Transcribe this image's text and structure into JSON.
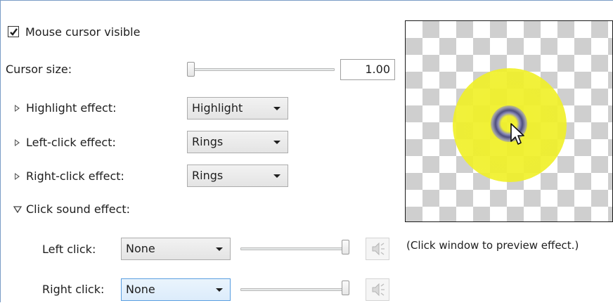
{
  "mouse_cursor_visible": {
    "label": "Mouse cursor visible",
    "checked": true
  },
  "cursor_size": {
    "label": "Cursor size:",
    "value": "1.00",
    "slider_fraction": 0.0
  },
  "effects": [
    {
      "label": "Highlight effect:",
      "selected": "Highlight",
      "expanded": false
    },
    {
      "label": "Left-click effect:",
      "selected": "Rings",
      "expanded": false
    },
    {
      "label": "Right-click effect:",
      "selected": "Rings",
      "expanded": false
    }
  ],
  "click_sound": {
    "label": "Click sound effect:",
    "expanded": true,
    "left": {
      "label": "Left click:",
      "selected": "None",
      "volume_fraction": 1.0
    },
    "right": {
      "label": "Right click:",
      "selected": "None",
      "volume_fraction": 1.0
    }
  },
  "preview": {
    "caption": "(Click window to preview effect.)"
  },
  "colors": {
    "highlight": "#f0f028",
    "ring": "#46468a",
    "accent_border": "#5a9ee0"
  },
  "icons": {
    "checkmark": "checkmark-icon",
    "expand": "triangle-right-icon",
    "collapse": "triangle-down-icon",
    "dropdown": "chevron-down-icon",
    "speaker": "speaker-icon",
    "cursor": "mouse-pointer-icon"
  }
}
